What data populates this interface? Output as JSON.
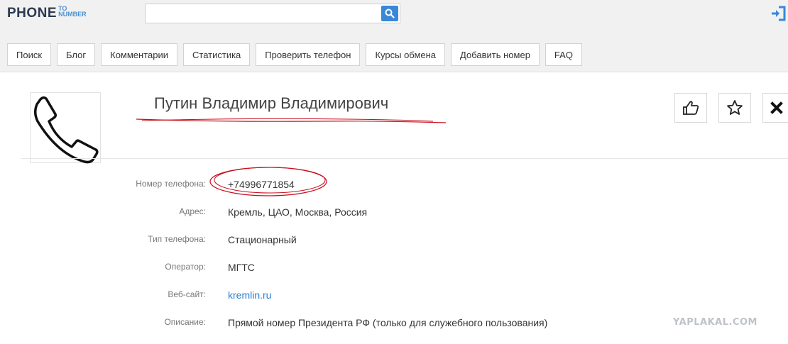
{
  "header": {
    "logo_main": "PHONE",
    "logo_to": "TO",
    "logo_number": "NUMBER",
    "search_value": "",
    "search_placeholder": ""
  },
  "nav": {
    "items": [
      "Поиск",
      "Блог",
      "Комментарии",
      "Статистика",
      "Проверить телефон",
      "Курсы обмена",
      "Добавить номер",
      "FAQ"
    ]
  },
  "profile": {
    "name": "Путин Владимир Владимирович",
    "avatar_icon": "phone-handset-icon"
  },
  "actions": {
    "like_icon": "thumbs-up-icon",
    "favorite_icon": "star-icon",
    "close_icon": "close-icon"
  },
  "details": [
    {
      "label": "Номер телефона:",
      "value": "+74996771854"
    },
    {
      "label": "Адрес:",
      "value": "Кремль, ЦАО, Москва, Россия"
    },
    {
      "label": "Тип телефона:",
      "value": "Стационарный"
    },
    {
      "label": "Оператор:",
      "value": "МГТС"
    },
    {
      "label": "Веб-сайт:",
      "value": "kremlin.ru"
    },
    {
      "label": "Описание:",
      "value": "Прямой номер Президента РФ (только для служебного пользования)"
    }
  ],
  "watermark": "YAPLAKAL.COM",
  "colors": {
    "accent": "#3a87d8",
    "annotation": "#c8101e",
    "link": "#2a7bd0"
  }
}
